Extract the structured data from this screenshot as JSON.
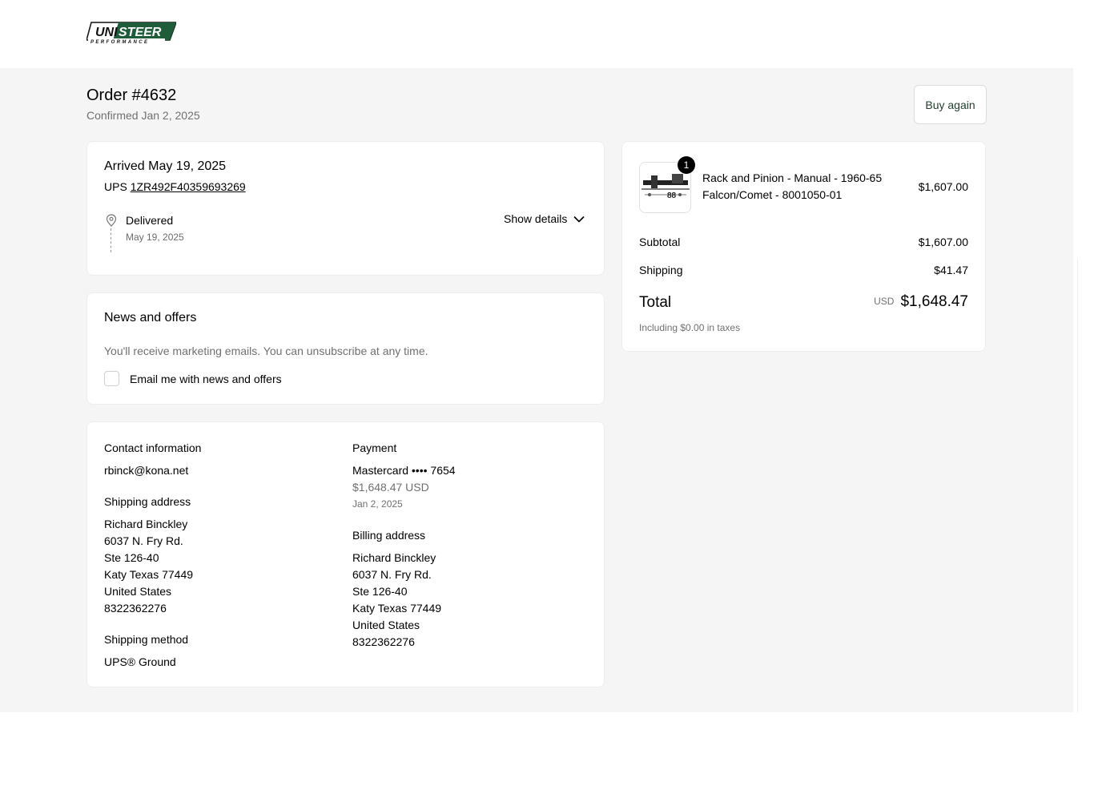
{
  "brand": {
    "logo_main": "UNISTEER",
    "logo_sub": "PERFORMANCE",
    "accent": "#1f5c3a"
  },
  "order": {
    "title": "Order #4632",
    "confirmed": "Confirmed Jan 2, 2025",
    "buy_again": "Buy again"
  },
  "delivery": {
    "arrived": "Arrived May 19, 2025",
    "carrier": "UPS",
    "tracking_number": "1ZR492F40359693269",
    "status": "Delivered",
    "status_date": "May 19, 2025",
    "show_details": "Show details"
  },
  "news": {
    "title": "News and offers",
    "description": "You'll receive marketing emails. You can unsubscribe at any time.",
    "checkbox_label": "Email me with news and offers",
    "checked": false
  },
  "contact": {
    "heading": "Contact information",
    "email": "rbinck@kona.net"
  },
  "shipping_address": {
    "heading": "Shipping address",
    "lines": [
      "Richard Binckley",
      "6037 N. Fry Rd.",
      "Ste 126-40",
      "Katy Texas 77449",
      "United States",
      "8322362276"
    ]
  },
  "shipping_method": {
    "heading": "Shipping method",
    "value": "UPS® Ground"
  },
  "payment": {
    "heading": "Payment",
    "card": "Mastercard •••• 7654",
    "amount": "$1,648.47 USD",
    "date": "Jan 2, 2025"
  },
  "billing_address": {
    "heading": "Billing address",
    "lines": [
      "Richard Binckley",
      "6037 N. Fry Rd.",
      "Ste 126-40",
      "Katy Texas 77449",
      "United States",
      "8322362276"
    ]
  },
  "summary": {
    "item": {
      "quantity": "1",
      "name": "Rack and Pinion - Manual - 1960-65 Falcon/Comet - 8001050-01",
      "price": "$1,607.00"
    },
    "subtotal_label": "Subtotal",
    "subtotal": "$1,607.00",
    "shipping_label": "Shipping",
    "shipping": "$41.47",
    "total_label": "Total",
    "currency": "USD",
    "total": "$1,648.47",
    "taxes": "Including $0.00 in taxes"
  }
}
